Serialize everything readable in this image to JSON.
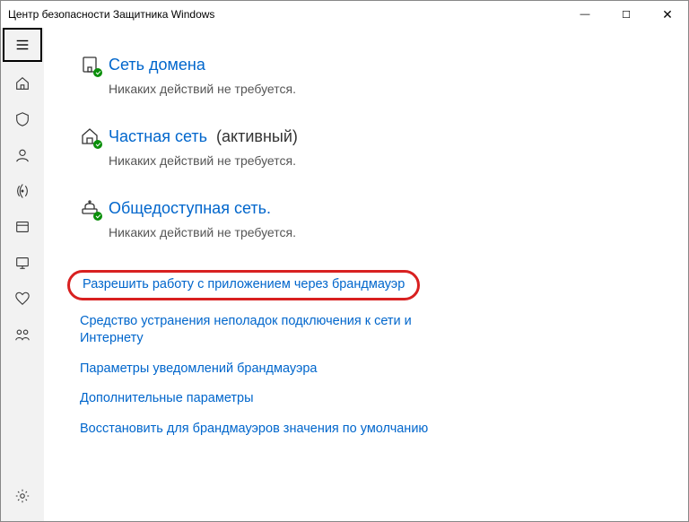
{
  "window": {
    "title": "Центр безопасности Защитника Windows"
  },
  "sections": {
    "domain": {
      "title": "Сеть домена",
      "desc": "Никаких действий не требуется."
    },
    "private": {
      "title": "Частная сеть",
      "suffix": "(активный)",
      "desc": "Никаких действий не требуется."
    },
    "public": {
      "title": "Общедоступная сеть.",
      "desc": "Никаких действий не требуется."
    }
  },
  "links": {
    "allow_app": "Разрешить работу с приложением через брандмауэр",
    "troubleshoot": "Средство устранения неполадок подключения к сети и Интернету",
    "notifications": "Параметры уведомлений брандмауэра",
    "advanced": "Дополнительные параметры",
    "restore": "Восстановить для брандмауэров значения по умолчанию"
  }
}
